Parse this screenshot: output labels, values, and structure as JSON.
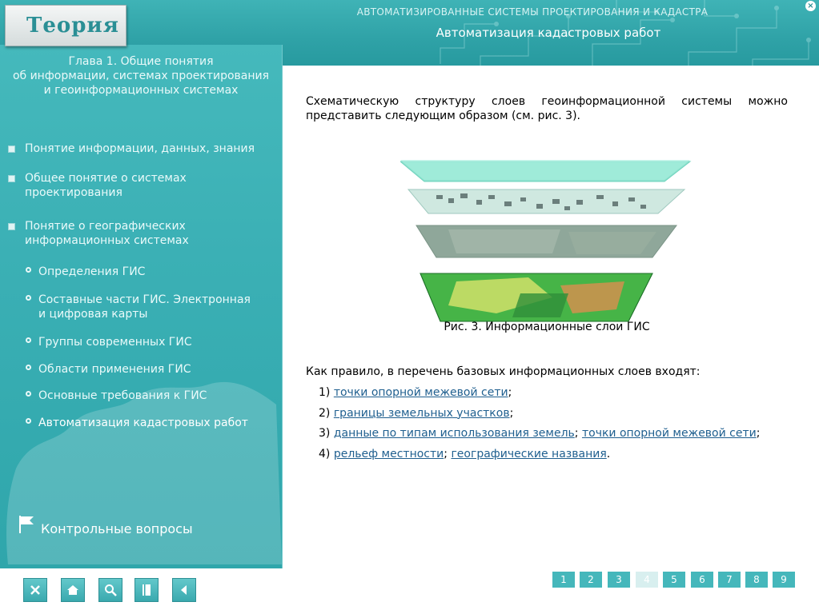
{
  "header": {
    "tab_label": "Теория",
    "sup_title": "АВТОМАТИЗИРОВАННЫЕ СИСТЕМЫ ПРОЕКТИРОВАНИЯ И КАДАСТРА",
    "page_title": "Автоматизация кадастровых работ",
    "accent": "#2fa2a7"
  },
  "sidebar": {
    "chapter_lines": [
      "Глава 1. Общие понятия",
      "об информации, системах проектирования",
      "и геоинформационных системах"
    ],
    "items": [
      {
        "line1": "Понятие информации, данных, знания",
        "line2": ""
      },
      {
        "line1": "Общее понятие о системах",
        "line2": "проектирования"
      },
      {
        "line1": "Понятие о географических",
        "line2": "информационных системах"
      }
    ],
    "subitems": [
      {
        "line1": "Определения ГИС",
        "line2": ""
      },
      {
        "line1": "Составные части ГИС. Электронная",
        "line2": "и цифровая карты"
      },
      {
        "line1": "Группы современных ГИС",
        "line2": ""
      },
      {
        "line1": "Области применения ГИС",
        "line2": ""
      },
      {
        "line1": "Основные требования к ГИС",
        "line2": ""
      },
      {
        "line1": "Автоматизация кадастровых работ",
        "line2": ""
      }
    ],
    "control_questions": "Контрольные вопросы"
  },
  "toolbar": {
    "buttons": [
      "close-icon",
      "home-icon",
      "search-icon",
      "book-icon",
      "back-arrow-icon"
    ]
  },
  "pager": {
    "pages": [
      "1",
      "2",
      "3",
      "4",
      "5",
      "6",
      "7",
      "8",
      "9"
    ],
    "current": "4"
  },
  "content": {
    "intro": "Схематическую структуру слоев геоинформационной системы можно представить следующим образом (см. рис. 3).",
    "caption": "Рис. 3. Информационные слои ГИС",
    "lead": "Как правило, в перечень базовых информационных слоев входят:",
    "list": [
      {
        "num": "1)",
        "link1": "точки опорной межевой сети",
        "sep": "",
        "link2": "",
        "end": ";"
      },
      {
        "num": "2)",
        "link1": "границы земельных участков",
        "sep": "",
        "link2": "",
        "end": ";"
      },
      {
        "num": "3)",
        "link1": "данные по типам использования земель",
        "sep": "; ",
        "link2": "точки опорной межевой сети",
        "end": ";"
      },
      {
        "num": "4)",
        "link1": "рельеф местности",
        "sep": "; ",
        "link2": "географические названия",
        "end": "."
      }
    ]
  }
}
